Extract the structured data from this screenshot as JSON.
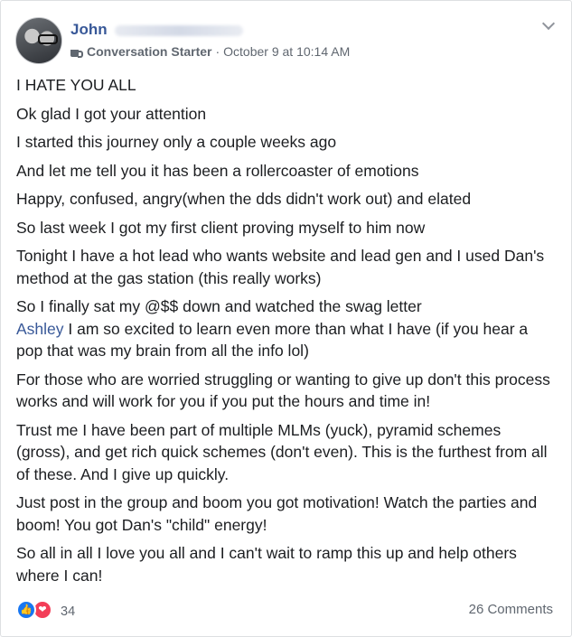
{
  "post": {
    "author_name": "John",
    "badge": "Conversation Starter",
    "separator": "·",
    "timestamp": "October 9 at 10:14 AM",
    "paragraphs": [
      "I HATE YOU ALL",
      "Ok glad I got your attention",
      "I started this journey only a couple weeks ago",
      "And let me tell you it has been a rollercoaster of emotions",
      "Happy, confused, angry(when the dds didn't work out) and elated",
      "So last week I got my first client proving myself to him now",
      "Tonight I have a hot lead who wants website and lead gen and I used Dan's method at the gas station (this really works)",
      "So I finally sat my @$$ down and watched the swag letter",
      "I am so excited to learn even more than what I have (if you hear a pop that was my brain from all the info lol)",
      "For those who are worried struggling or wanting to give up don't this process works and will work for you if you put the hours and time in!",
      "Trust me I have been part of multiple MLMs (yuck), pyramid schemes (gross), and get rich quick schemes (don't even). This is the furthest from all of these. And I give up quickly.",
      "Just post in the group and boom you got motivation! Watch the parties and boom! You got Dan's \"child\" energy!",
      "So all in all I love you all and I can't wait to ramp this up and help others where I can!"
    ],
    "mention": "Ashley",
    "reaction_count": "34",
    "comments": "26 Comments"
  },
  "icons": {
    "badge": "coffee-cup-icon",
    "menu": "chevron-down-icon",
    "like": "like-reaction-icon",
    "love": "love-reaction-icon"
  },
  "colors": {
    "link": "#385898",
    "like": "#1877f2",
    "love": "#f33e58",
    "meta": "#606770"
  }
}
